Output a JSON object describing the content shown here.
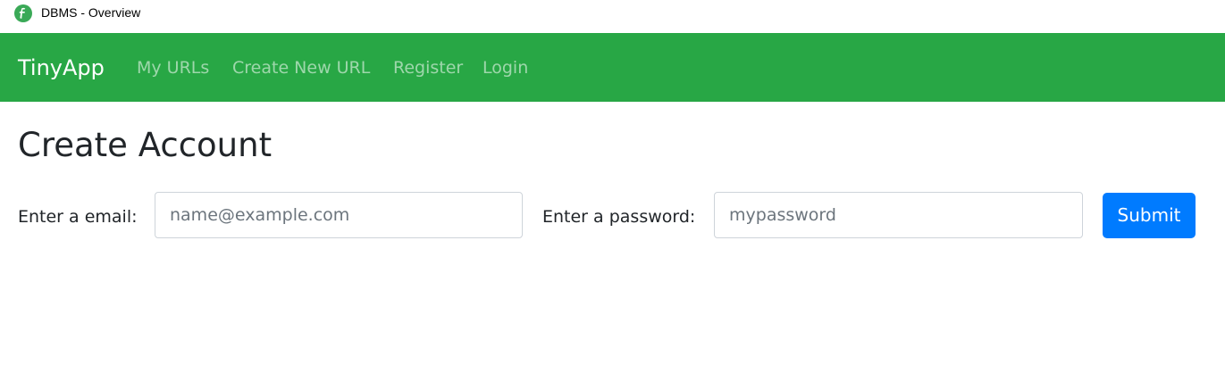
{
  "tab": {
    "favicon": "tinyapp-logo-icon",
    "title": "DBMS - Overview"
  },
  "navbar": {
    "background": "#28a745",
    "brand": "TinyApp",
    "links": [
      {
        "label": "My URLs"
      },
      {
        "label": "Create New URL"
      },
      {
        "label": "Register"
      },
      {
        "label": "Login"
      }
    ]
  },
  "main": {
    "title": "Create Account",
    "email": {
      "label": "Enter a email:",
      "placeholder": "name@example.com",
      "value": ""
    },
    "password": {
      "label": "Enter a password:",
      "placeholder": "mypassword",
      "value": ""
    },
    "submit_label": "Submit",
    "submit_color": "#007bff"
  }
}
